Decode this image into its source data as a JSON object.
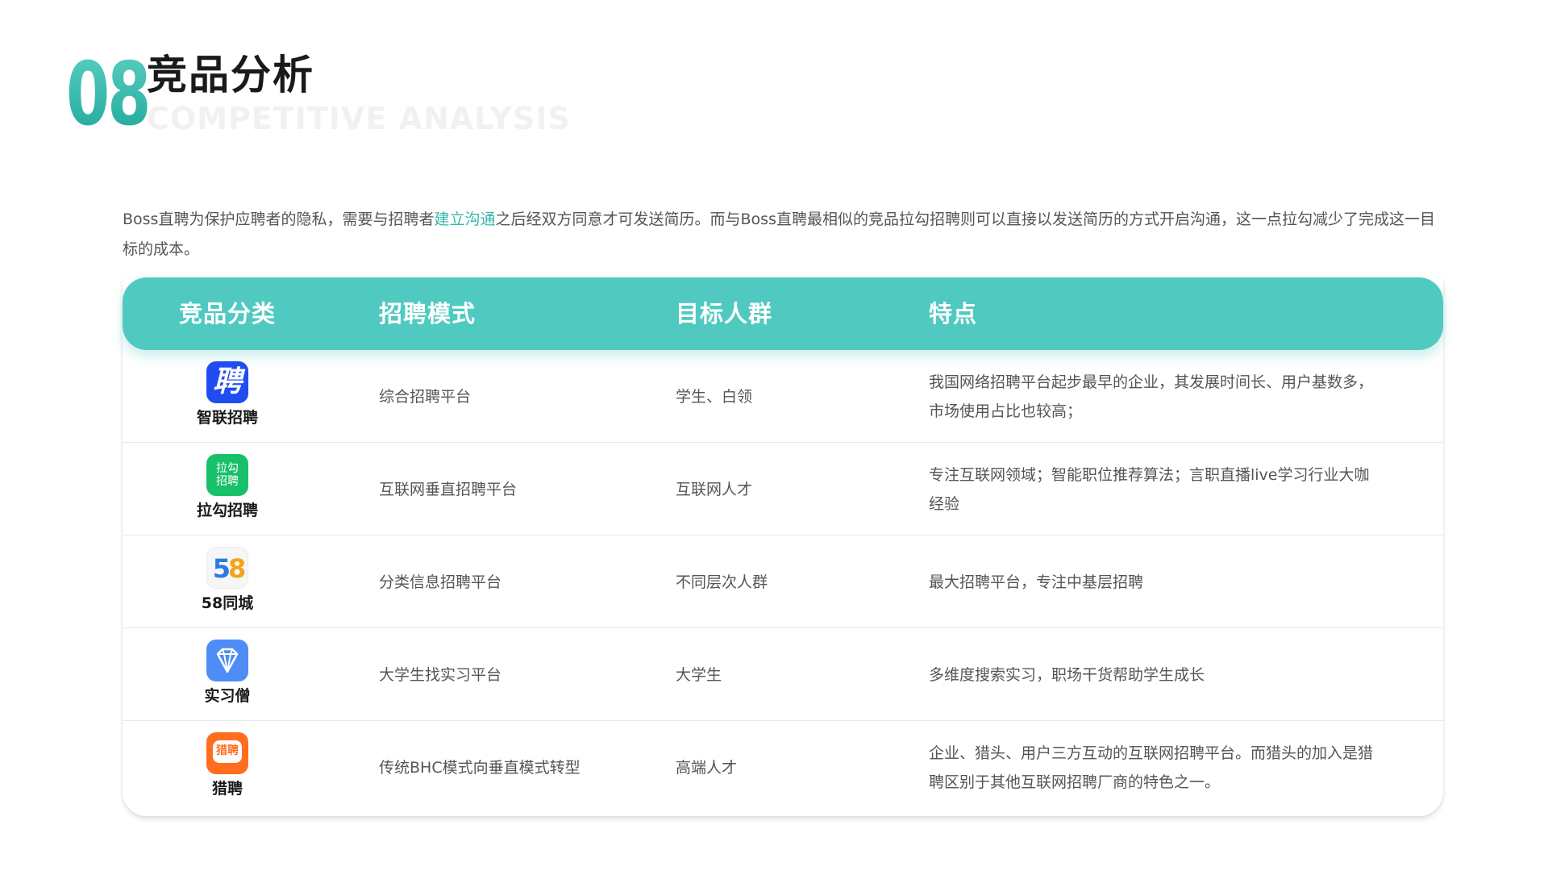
{
  "header": {
    "number": "08",
    "title": "竞品分析",
    "subtitle": "COMPETITIVE ANALYSIS"
  },
  "intro": {
    "text_before": "Boss直聘为保护应聘者的隐私，需要与招聘者",
    "highlight": "建立沟通",
    "text_after": "之后经双方同意才可发送简历。而与Boss直聘最相似的竞品拉勾招聘则可以直接以发送简历的方式开启沟通，这一点拉勾减少了完成这一目标的成本。",
    "highlight_color": "#35b7ad"
  },
  "table": {
    "headers": [
      "竞品分类",
      "招聘模式",
      "目标人群",
      "特点"
    ],
    "header_color": "#50cac1",
    "rows": [
      {
        "name": "智联招聘",
        "icon": "zhilian-logo-icon",
        "logo_glyph": "聘",
        "mode": "综合招聘平台",
        "target": "学生、白领",
        "feature": "我国网络招聘平台起步最早的企业，其发展时间长、用户基数多，市场使用占比也较高；"
      },
      {
        "name": "拉勾招聘",
        "icon": "lagou-logo-icon",
        "logo_line1": "拉勾",
        "logo_line2": "招聘",
        "mode": "互联网垂直招聘平台",
        "target": "互联网人才",
        "feature": "专注互联网领域；智能职位推荐算法；言职直播live学习行业大咖经验"
      },
      {
        "name": "58同城",
        "icon": "58-logo-icon",
        "logo_glyph_a": "5",
        "logo_glyph_b": "8",
        "mode": "分类信息招聘平台",
        "target": "不同层次人群",
        "feature": "最大招聘平台，专注中基层招聘"
      },
      {
        "name": "实习僧",
        "icon": "shixiseng-diamond-icon",
        "mode": "大学生找实习平台",
        "target": "大学生",
        "feature": "多维度搜索实习，职场干货帮助学生成长"
      },
      {
        "name": "猎聘",
        "icon": "liepin-logo-icon",
        "logo_glyph": "猎聘",
        "mode": "传统BHC模式向垂直模式转型",
        "target": "高端人才",
        "feature": "企业、猎头、用户三方互动的互联网招聘平台。而猎头的加入是猎聘区别于其他互联网招聘厂商的特色之一。"
      }
    ]
  }
}
